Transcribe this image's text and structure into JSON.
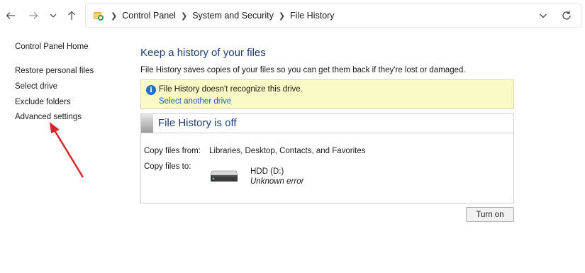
{
  "breadcrumb": {
    "items": [
      "Control Panel",
      "System and Security",
      "File History"
    ]
  },
  "leftnav": {
    "home": "Control Panel Home",
    "items": [
      "Restore personal files",
      "Select drive",
      "Exclude folders",
      "Advanced settings"
    ]
  },
  "main": {
    "heading": "Keep a history of your files",
    "description": "File History saves copies of your files so you can get them back if they're lost or damaged.",
    "warning": {
      "message": "File History doesn't recognize this drive.",
      "link": "Select another drive"
    },
    "status": {
      "title": "File History is off",
      "copy_from_label": "Copy files from:",
      "copy_from_value": "Libraries, Desktop, Contacts, and Favorites",
      "copy_to_label": "Copy files to:",
      "drive_name": "HDD (D:)",
      "drive_status": "Unknown error"
    },
    "turn_on_label": "Turn on"
  },
  "colors": {
    "heading": "#1e3d6e",
    "link": "#1a5fb0",
    "warning_bg": "#fafac6",
    "info_icon": "#1e6fc8",
    "annotation_arrow": "#d9262b"
  },
  "icons": {
    "back": "back-arrow-icon",
    "forward": "forward-arrow-icon",
    "recent": "chevron-down-icon",
    "up": "up-arrow-icon",
    "location": "control-panel-icon",
    "dropdown": "chevron-down-icon",
    "refresh": "refresh-icon",
    "info": "info-icon",
    "drive": "hard-drive-icon"
  }
}
